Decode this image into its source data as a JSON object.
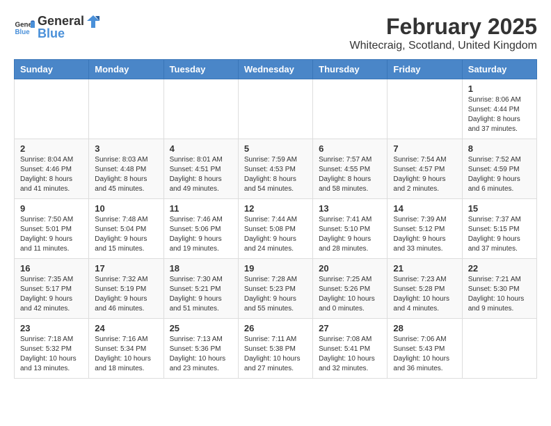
{
  "header": {
    "logo_general": "General",
    "logo_blue": "Blue",
    "title": "February 2025",
    "subtitle": "Whitecraig, Scotland, United Kingdom"
  },
  "calendar": {
    "days_of_week": [
      "Sunday",
      "Monday",
      "Tuesday",
      "Wednesday",
      "Thursday",
      "Friday",
      "Saturday"
    ],
    "weeks": [
      [
        {
          "day": "",
          "info": ""
        },
        {
          "day": "",
          "info": ""
        },
        {
          "day": "",
          "info": ""
        },
        {
          "day": "",
          "info": ""
        },
        {
          "day": "",
          "info": ""
        },
        {
          "day": "",
          "info": ""
        },
        {
          "day": "1",
          "info": "Sunrise: 8:06 AM\nSunset: 4:44 PM\nDaylight: 8 hours and 37 minutes."
        }
      ],
      [
        {
          "day": "2",
          "info": "Sunrise: 8:04 AM\nSunset: 4:46 PM\nDaylight: 8 hours and 41 minutes."
        },
        {
          "day": "3",
          "info": "Sunrise: 8:03 AM\nSunset: 4:48 PM\nDaylight: 8 hours and 45 minutes."
        },
        {
          "day": "4",
          "info": "Sunrise: 8:01 AM\nSunset: 4:51 PM\nDaylight: 8 hours and 49 minutes."
        },
        {
          "day": "5",
          "info": "Sunrise: 7:59 AM\nSunset: 4:53 PM\nDaylight: 8 hours and 54 minutes."
        },
        {
          "day": "6",
          "info": "Sunrise: 7:57 AM\nSunset: 4:55 PM\nDaylight: 8 hours and 58 minutes."
        },
        {
          "day": "7",
          "info": "Sunrise: 7:54 AM\nSunset: 4:57 PM\nDaylight: 9 hours and 2 minutes."
        },
        {
          "day": "8",
          "info": "Sunrise: 7:52 AM\nSunset: 4:59 PM\nDaylight: 9 hours and 6 minutes."
        }
      ],
      [
        {
          "day": "9",
          "info": "Sunrise: 7:50 AM\nSunset: 5:01 PM\nDaylight: 9 hours and 11 minutes."
        },
        {
          "day": "10",
          "info": "Sunrise: 7:48 AM\nSunset: 5:04 PM\nDaylight: 9 hours and 15 minutes."
        },
        {
          "day": "11",
          "info": "Sunrise: 7:46 AM\nSunset: 5:06 PM\nDaylight: 9 hours and 19 minutes."
        },
        {
          "day": "12",
          "info": "Sunrise: 7:44 AM\nSunset: 5:08 PM\nDaylight: 9 hours and 24 minutes."
        },
        {
          "day": "13",
          "info": "Sunrise: 7:41 AM\nSunset: 5:10 PM\nDaylight: 9 hours and 28 minutes."
        },
        {
          "day": "14",
          "info": "Sunrise: 7:39 AM\nSunset: 5:12 PM\nDaylight: 9 hours and 33 minutes."
        },
        {
          "day": "15",
          "info": "Sunrise: 7:37 AM\nSunset: 5:15 PM\nDaylight: 9 hours and 37 minutes."
        }
      ],
      [
        {
          "day": "16",
          "info": "Sunrise: 7:35 AM\nSunset: 5:17 PM\nDaylight: 9 hours and 42 minutes."
        },
        {
          "day": "17",
          "info": "Sunrise: 7:32 AM\nSunset: 5:19 PM\nDaylight: 9 hours and 46 minutes."
        },
        {
          "day": "18",
          "info": "Sunrise: 7:30 AM\nSunset: 5:21 PM\nDaylight: 9 hours and 51 minutes."
        },
        {
          "day": "19",
          "info": "Sunrise: 7:28 AM\nSunset: 5:23 PM\nDaylight: 9 hours and 55 minutes."
        },
        {
          "day": "20",
          "info": "Sunrise: 7:25 AM\nSunset: 5:26 PM\nDaylight: 10 hours and 0 minutes."
        },
        {
          "day": "21",
          "info": "Sunrise: 7:23 AM\nSunset: 5:28 PM\nDaylight: 10 hours and 4 minutes."
        },
        {
          "day": "22",
          "info": "Sunrise: 7:21 AM\nSunset: 5:30 PM\nDaylight: 10 hours and 9 minutes."
        }
      ],
      [
        {
          "day": "23",
          "info": "Sunrise: 7:18 AM\nSunset: 5:32 PM\nDaylight: 10 hours and 13 minutes."
        },
        {
          "day": "24",
          "info": "Sunrise: 7:16 AM\nSunset: 5:34 PM\nDaylight: 10 hours and 18 minutes."
        },
        {
          "day": "25",
          "info": "Sunrise: 7:13 AM\nSunset: 5:36 PM\nDaylight: 10 hours and 23 minutes."
        },
        {
          "day": "26",
          "info": "Sunrise: 7:11 AM\nSunset: 5:38 PM\nDaylight: 10 hours and 27 minutes."
        },
        {
          "day": "27",
          "info": "Sunrise: 7:08 AM\nSunset: 5:41 PM\nDaylight: 10 hours and 32 minutes."
        },
        {
          "day": "28",
          "info": "Sunrise: 7:06 AM\nSunset: 5:43 PM\nDaylight: 10 hours and 36 minutes."
        },
        {
          "day": "",
          "info": ""
        }
      ]
    ]
  }
}
